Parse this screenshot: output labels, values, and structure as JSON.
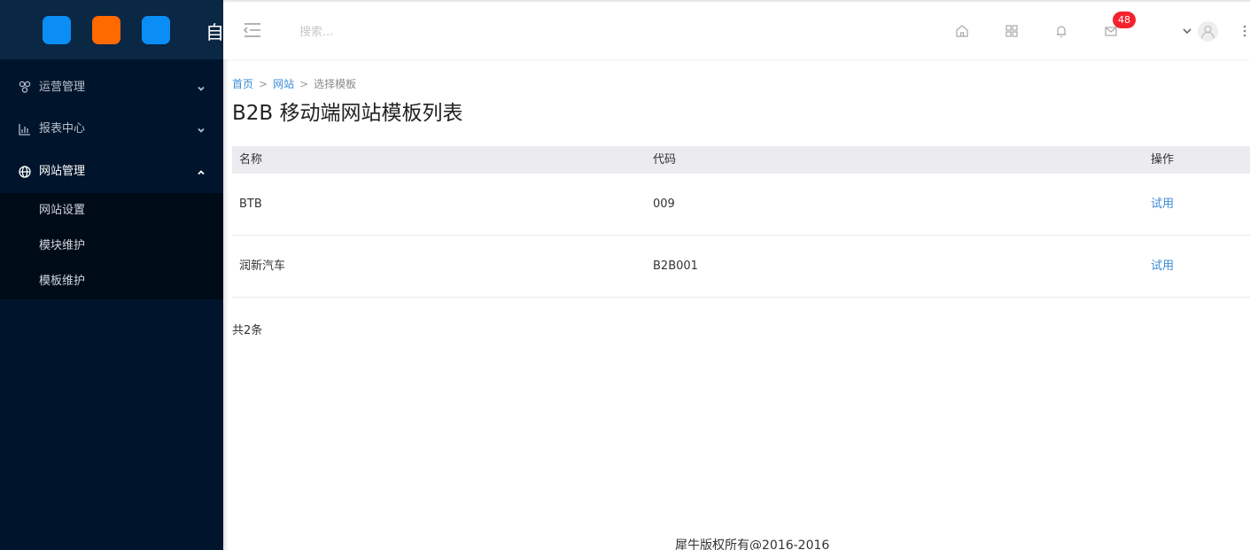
{
  "sidebar": {
    "brand_char": "自",
    "logo_colors": [
      "#0a8ef5",
      "#ff6a00",
      "#0a8ef5"
    ],
    "menu": [
      {
        "label": "运营管理",
        "icon": "nodes-icon",
        "expanded": false
      },
      {
        "label": "报表中心",
        "icon": "bar-chart-icon",
        "expanded": false
      },
      {
        "label": "网站管理",
        "icon": "globe-icon",
        "expanded": true
      }
    ],
    "submenu": [
      {
        "label": "网站设置"
      },
      {
        "label": "模块维护"
      },
      {
        "label": "模板维护"
      }
    ]
  },
  "header": {
    "search_placeholder": "搜索...",
    "mail_badge": "48"
  },
  "breadcrumb": [
    {
      "label": "首页"
    },
    {
      "label": "网站"
    },
    {
      "label": "选择模板"
    }
  ],
  "breadcrumb_sep": ">",
  "page_title": "B2B 移动端网站模板列表",
  "table": {
    "columns": [
      "名称",
      "代码",
      "操作"
    ],
    "rows": [
      {
        "name": "BTB",
        "code": "009",
        "action": "试用"
      },
      {
        "name": "润新汽车",
        "code": "B2B001",
        "action": "试用"
      }
    ]
  },
  "total_text": "共2条",
  "footer": "犀牛版权所有@2016-2016",
  "colors": {
    "sidebar_bg": "#00152c",
    "sidebar_top_bg": "#0a2744",
    "link": "#3b8bd6",
    "badge": "#f5222d"
  }
}
